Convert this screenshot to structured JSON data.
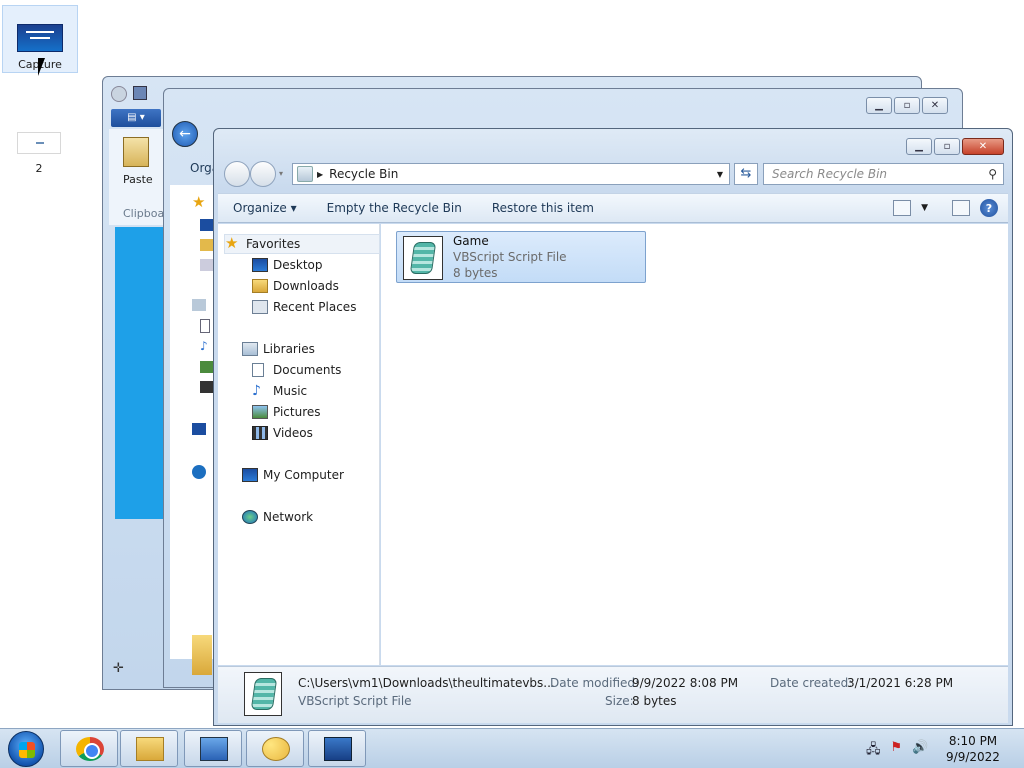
{
  "desktop": {
    "icons": [
      {
        "label": "Capture"
      },
      {
        "label": "2"
      }
    ]
  },
  "back_window": {
    "ribbon_paste": "Paste",
    "ribbon_clipboard": "Clipboa"
  },
  "middle_window": {
    "toolbar_partial": "Orga"
  },
  "main_window": {
    "address": "Recycle Bin",
    "search_placeholder": "Search Recycle Bin",
    "toolbar": {
      "organize": "Organize",
      "empty": "Empty the Recycle Bin",
      "restore": "Restore this item"
    },
    "nav": {
      "favorites": "Favorites",
      "desktop": "Desktop",
      "downloads": "Downloads",
      "recent": "Recent Places",
      "libraries": "Libraries",
      "documents": "Documents",
      "music": "Music",
      "pictures": "Pictures",
      "videos": "Videos",
      "computer": "My Computer",
      "network": "Network"
    },
    "file": {
      "name": "Game",
      "type": "VBScript Script File",
      "size": "8 bytes"
    },
    "details": {
      "path": "C:\\Users\\vm1\\Downloads\\theultimatevbs...",
      "type": "VBScript Script File",
      "modified_label": "Date modified:",
      "modified_value": "9/9/2022 8:08 PM",
      "size_label": "Size:",
      "size_value": "8 bytes",
      "created_label": "Date created:",
      "created_value": "3/1/2021 6:28 PM"
    }
  },
  "taskbar": {
    "time": "8:10 PM",
    "date": "9/9/2022"
  }
}
